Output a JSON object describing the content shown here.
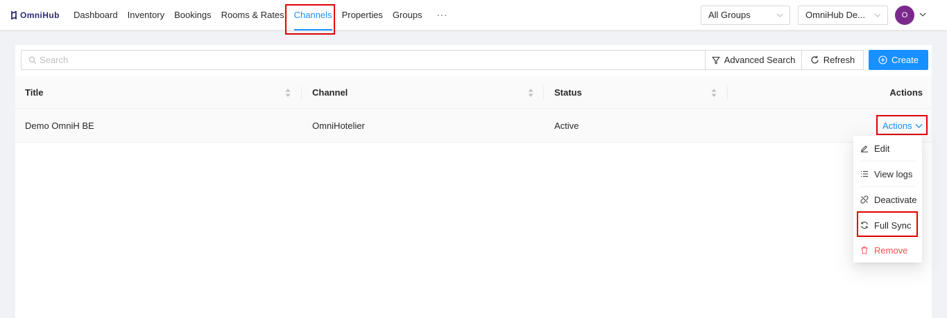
{
  "app": {
    "logo_text": "OmniHub"
  },
  "nav": {
    "items": [
      "Dashboard",
      "Inventory",
      "Bookings",
      "Rooms & Rates",
      "Channels",
      "Properties",
      "Groups"
    ],
    "active": "Channels",
    "more": "···"
  },
  "header": {
    "group_select": "All Groups",
    "account_select": "OmniHub De...",
    "avatar_initial": "O"
  },
  "toolbar": {
    "search_placeholder": "Search",
    "advanced_search": "Advanced Search",
    "refresh": "Refresh",
    "create": "Create"
  },
  "table": {
    "columns": [
      "Title",
      "Channel",
      "Status",
      "Actions"
    ],
    "rows": [
      {
        "title": "Demo OmniH BE",
        "channel": "OmniHotelier",
        "status": "Active",
        "actions": "Actions"
      }
    ]
  },
  "dropdown": {
    "items": [
      {
        "label": "Edit",
        "icon": "edit-icon"
      },
      {
        "label": "View logs",
        "icon": "list-icon"
      },
      {
        "label": "Deactivate",
        "icon": "disconnect-icon"
      },
      {
        "label": "Full Sync",
        "icon": "sync-icon"
      },
      {
        "label": "Remove",
        "icon": "trash-icon"
      }
    ]
  },
  "colors": {
    "primary": "#1890ff",
    "danger": "#ff4d4f",
    "highlight": "#e00000",
    "avatar": "#7b2a8c"
  }
}
